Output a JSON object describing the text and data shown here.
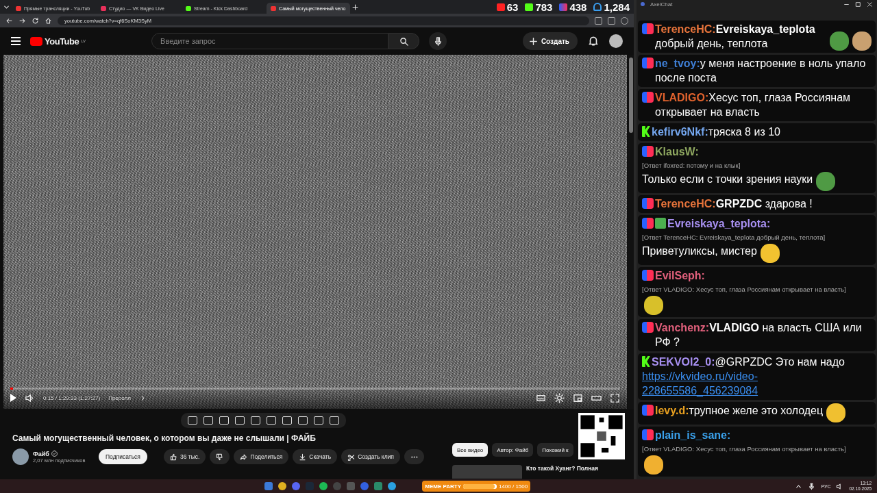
{
  "browser": {
    "tabs": [
      {
        "kind": "youtube",
        "label": "Прямые трансляции - YouTub",
        "selected": false
      },
      {
        "kind": "vk",
        "label": "Студио — VK Видео Live",
        "selected": false
      },
      {
        "kind": "kick",
        "label": "Stream - Kick Dashboard",
        "selected": false
      },
      {
        "kind": "youtube",
        "label": "Самый могущественный чело",
        "selected": true
      }
    ],
    "stats": [
      {
        "kind": "youtube",
        "value": "63"
      },
      {
        "kind": "kick",
        "value": "783"
      },
      {
        "kind": "vk",
        "value": "438"
      },
      {
        "kind": "person",
        "value": "1,284"
      }
    ],
    "address": "youtube.com/watch?v=qf6SoKM3SyM"
  },
  "youtube": {
    "logo": "YouTube",
    "region": "LV",
    "search": {
      "placeholder": "Введите запрос"
    },
    "create": "Создать",
    "player": {
      "level": 0.003,
      "time": "0:15 / 1:29:33 (1:27:27)",
      "chapter": "Преролл"
    },
    "title": "Самый могущественный человек, о котором вы даже не слышали | ФАЙБ",
    "channel": {
      "name": "Файб",
      "subscribers": "2,07 млн подписчиков",
      "subscribe": "Подписаться"
    },
    "actions": [
      {
        "kind": "like",
        "label": "36 тыс."
      },
      {
        "kind": "share",
        "label": "Поделиться"
      },
      {
        "kind": "download",
        "label": "Скачать"
      },
      {
        "kind": "clip",
        "label": "Создать клип"
      }
    ],
    "chips": [
      {
        "label": "Все видео",
        "selected": true
      },
      {
        "label": "Автор: Файб",
        "selected": false
      },
      {
        "label": "Похожий к",
        "selected": false
      }
    ],
    "recommendation": {
      "title": "Кто такой Хуанг? Полная"
    }
  },
  "chat": {
    "title": "AxelChat",
    "messages": [
      {
        "kind": "vk",
        "author": "TerenceHC:",
        "color": "#e8743b",
        "badge": false,
        "text": "**Evreiskaya_teplota** добрый день, теплота",
        "emotes": [
          {
            "color": "#4f9a44"
          },
          {
            "color": "#c9a070"
          }
        ]
      },
      {
        "kind": "vk",
        "author": "ne_tvoy:",
        "color": "#3f7fd6",
        "badge": false,
        "text": "у меня настроение в ноль упало после поста"
      },
      {
        "kind": "vk",
        "author": "VLADIGO:",
        "color": "#e0622d",
        "badge": false,
        "text": "Хесус топ, глаза Россиянам открывает на власть"
      },
      {
        "kind": "kick",
        "author": "kefirv6Nkf:",
        "color": "#74a6ee",
        "badge": false,
        "text": "тряска 8 из 10"
      },
      {
        "kind": "vk",
        "author": "KlausW:",
        "color": "#8fa860",
        "badge": false,
        "reply": "[Ответ ifoxred: потому и на клык]",
        "text": "Только если с точки зрения науки",
        "emotes": [
          {
            "color": "#4f9a44"
          }
        ]
      },
      {
        "kind": "vk",
        "author": "TerenceHC:",
        "color": "#e8743b",
        "badge": false,
        "text": "**GRPZDC** здарова !"
      },
      {
        "kind": "vk",
        "author": "Evreiskaya_teplota:",
        "color": "#a890f2",
        "badge": true,
        "reply": "[Ответ TerenceHC: Evreiskaya_teplota добрый день, теплота]",
        "text": "Приветуликсы, мистер",
        "emotes": [
          {
            "color": "#f2c230"
          }
        ]
      },
      {
        "kind": "vk",
        "author": "EvilSeph:",
        "color": "#e2607c",
        "badge": false,
        "reply": "[Ответ VLADIGO: Хесус топ, глаза Россиянам открывает на власть]",
        "emotes": [
          {
            "color": "#d8c02a"
          }
        ]
      },
      {
        "kind": "vk",
        "author": "Vanchenz:",
        "color": "#e2607c",
        "badge": false,
        "text": "**VLADIGO** на власть США или РФ ?"
      },
      {
        "kind": "kick",
        "author": "SEKVOI2_0:",
        "color": "#a890f2",
        "badge": false,
        "text": "@GRPZDC Это нам надо",
        "link": "https://vkvideo.ru/video-228655586_456239084"
      },
      {
        "kind": "vk",
        "author": "levy.d:",
        "color": "#e8a020",
        "badge": false,
        "text": "трупное желе это холодец",
        "emotes": [
          {
            "color": "#f0c030"
          }
        ]
      },
      {
        "kind": "vk",
        "author": "plain_is_sane:",
        "color": "#3aa0ea",
        "badge": false,
        "reply": "[Ответ VLADIGO: Хесус топ, глаза Россиянам открывает на власть]",
        "emotes": [
          {
            "color": "#f0b030"
          }
        ]
      }
    ]
  },
  "taskbar": {
    "widget": {
      "title": "MEME PARTY",
      "reading": "1400 / 1500",
      "level": 0.93
    },
    "language": "РУС",
    "time": "13:12",
    "date": "02.10.2025"
  }
}
